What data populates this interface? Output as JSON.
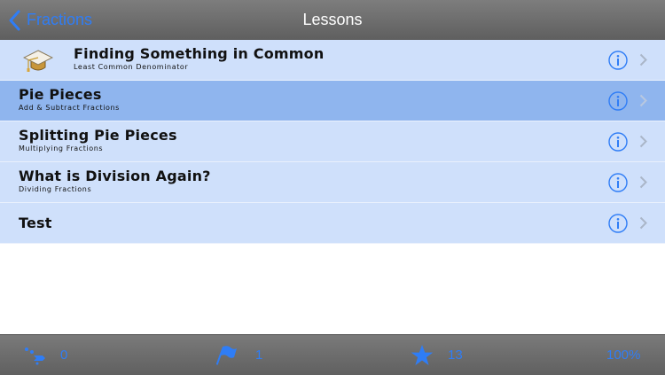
{
  "nav": {
    "back_label": "Fractions",
    "title": "Lessons"
  },
  "lessons": [
    {
      "title": "Finding Something in Common",
      "subtitle": "Least Common Denominator",
      "selected": false,
      "icon": "graduation-cap-icon"
    },
    {
      "title": "Pie Pieces",
      "subtitle": "Add & Subtract Fractions",
      "selected": true
    },
    {
      "title": "Splitting Pie Pieces",
      "subtitle": "Multiplying Fractions",
      "selected": false
    },
    {
      "title": "What is Division Again?",
      "subtitle": "Dividing Fractions",
      "selected": false
    },
    {
      "title": "Test",
      "subtitle": "",
      "selected": false
    }
  ],
  "toolbar": {
    "items": [
      {
        "icon": "trail-icon",
        "value": "0"
      },
      {
        "icon": "flag-icon",
        "value": "1"
      },
      {
        "icon": "star-icon",
        "value": "13"
      },
      {
        "icon": "",
        "value": "100%"
      }
    ]
  },
  "colors": {
    "accent": "#2f7df6",
    "row": "#cfe0fb",
    "row_selected": "#8fb5ee",
    "bar": "#6e6e6e"
  }
}
